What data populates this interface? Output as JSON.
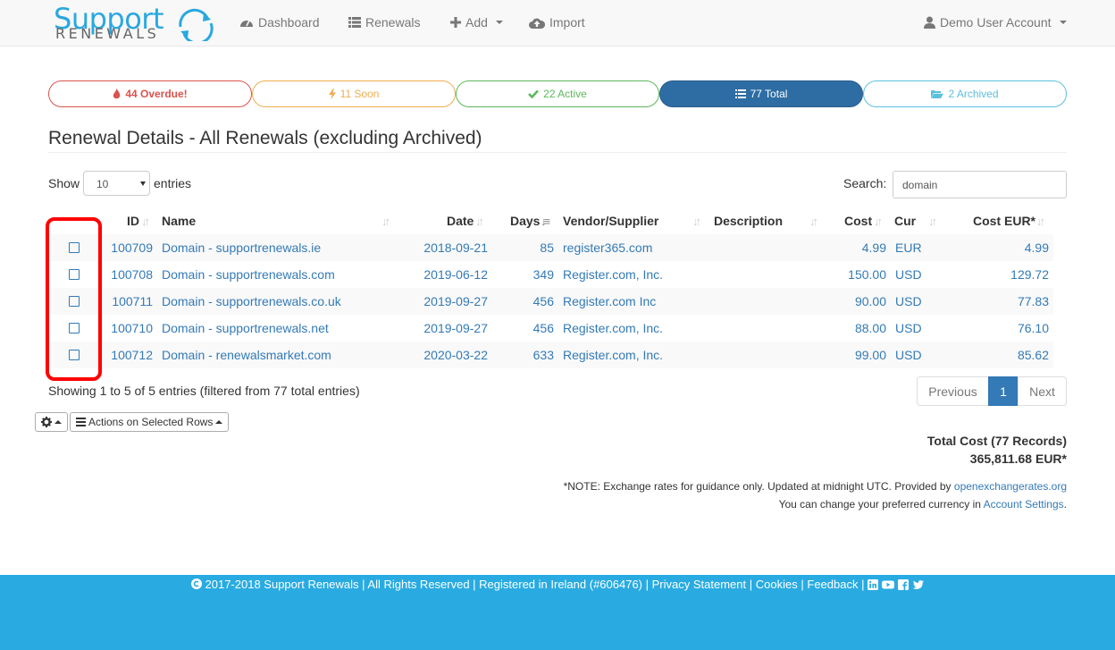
{
  "nav": {
    "logo_top": "Support",
    "logo_bottom": "RENEWALS",
    "dashboard": "Dashboard",
    "renewals": "Renewals",
    "add": "Add",
    "import": "Import",
    "account": "Demo User Account"
  },
  "pills": {
    "overdue": "44 Overdue!",
    "soon": "11 Soon",
    "active": "22 Active",
    "total": "77 Total",
    "archived": "2 Archived"
  },
  "heading": "Renewal Details - All Renewals (excluding Archived)",
  "controls": {
    "show": "Show",
    "length_value": "10",
    "entries": "entries",
    "search_label": "Search:",
    "search_value": "domain"
  },
  "table": {
    "headers": {
      "id": "ID",
      "name": "Name",
      "date": "Date",
      "days": "Days",
      "vendor": "Vendor/Supplier",
      "description": "Description",
      "cost": "Cost",
      "cur": "Cur",
      "cost_eur": "Cost EUR*"
    },
    "rows": [
      {
        "id": "100709",
        "name": "Domain - supportrenewals.ie",
        "date": "2018-09-21",
        "days": "85",
        "vendor": "register365.com",
        "description": "",
        "cost": "4.99",
        "cur": "EUR",
        "cost_eur": "4.99"
      },
      {
        "id": "100708",
        "name": "Domain - supportrenewals.com",
        "date": "2019-06-12",
        "days": "349",
        "vendor": "Register.com, Inc.",
        "description": "",
        "cost": "150.00",
        "cur": "USD",
        "cost_eur": "129.72"
      },
      {
        "id": "100711",
        "name": "Domain - supportrenewals.co.uk",
        "date": "2019-09-27",
        "days": "456",
        "vendor": "Register.com Inc",
        "description": "",
        "cost": "90.00",
        "cur": "USD",
        "cost_eur": "77.83"
      },
      {
        "id": "100710",
        "name": "Domain - supportrenewals.net",
        "date": "2019-09-27",
        "days": "456",
        "vendor": "Register.com, Inc.",
        "description": "",
        "cost": "88.00",
        "cur": "USD",
        "cost_eur": "76.10"
      },
      {
        "id": "100712",
        "name": "Domain - renewalsmarket.com",
        "date": "2020-03-22",
        "days": "633",
        "vendor": "Register.com, Inc.",
        "description": "",
        "cost": "99.00",
        "cur": "USD",
        "cost_eur": "85.62"
      }
    ]
  },
  "info": "Showing 1 to 5 of 5 entries (filtered from 77 total entries)",
  "pagination": {
    "previous": "Previous",
    "current": "1",
    "next": "Next"
  },
  "actions": {
    "selected_rows": "Actions on Selected Rows"
  },
  "totals": {
    "title": "Total Cost (77 Records)",
    "value": "365,811.68 EUR*"
  },
  "note": {
    "line1": "*NOTE: Exchange rates for guidance only. Updated at midnight UTC. Provided by ",
    "line1_link": "openexchangerates.org",
    "line2": "You can change your preferred currency in ",
    "line2_link": "Account Settings",
    "line2_end": "."
  },
  "footer": {
    "copyright": "2017-2018 Support Renewals | All Rights Reserved | Registered in Ireland (#606476) |",
    "privacy": "Privacy Statement",
    "sep1": "|",
    "cookies": "Cookies",
    "sep2": "|",
    "feedback": "Feedback",
    "sep3": "|"
  },
  "colors": {
    "brand": "#29a8e0",
    "link": "#337ab7",
    "overdue": "#d9534f",
    "soon": "#f0ad4e",
    "active": "#5cb85c",
    "total": "#2e6da4",
    "archived": "#5bc0de",
    "highlight": "#ff0000",
    "footer": "#29abe2"
  }
}
